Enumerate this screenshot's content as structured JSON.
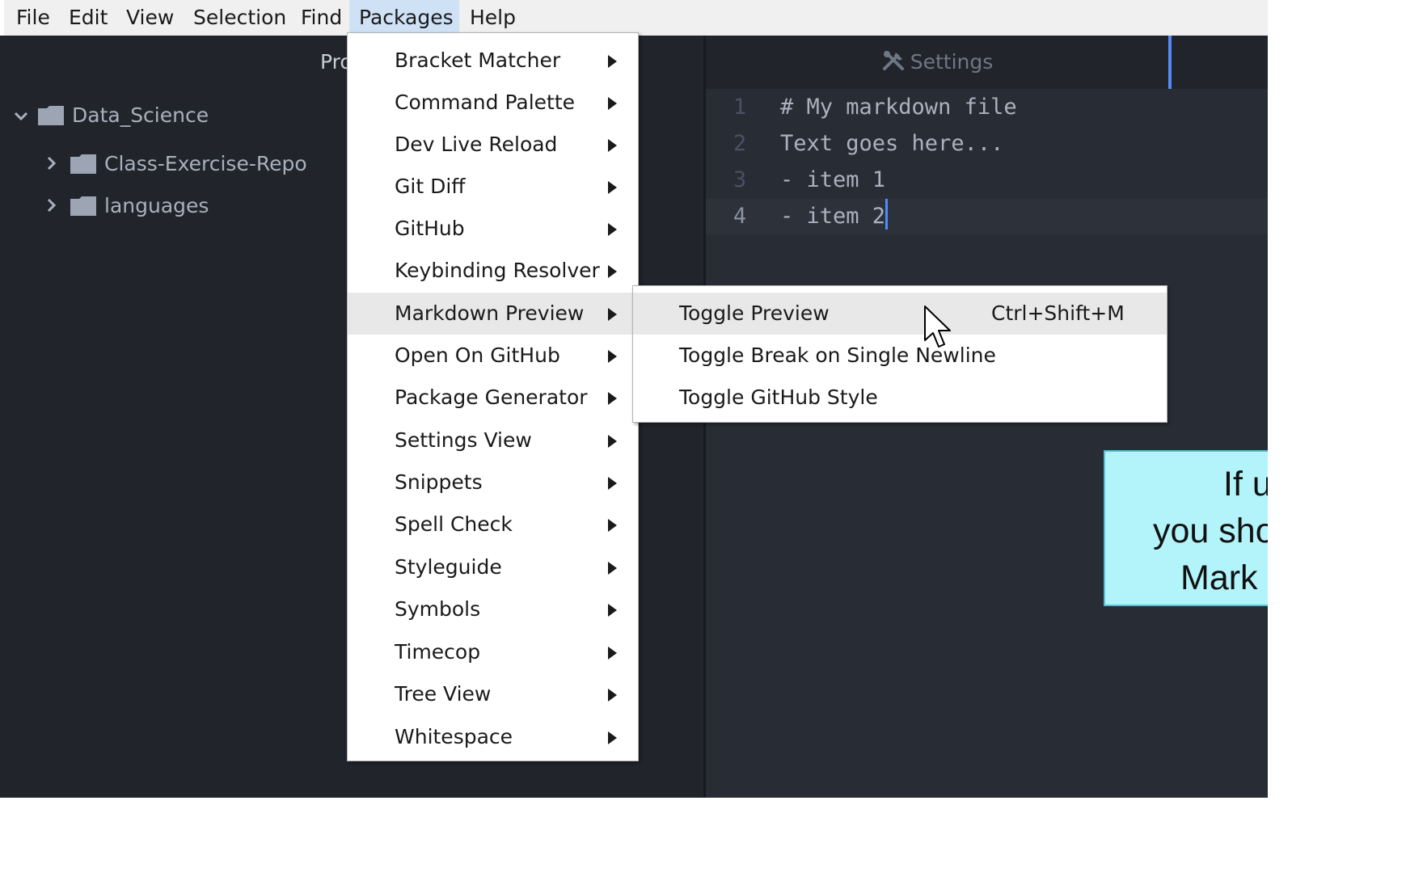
{
  "menubar": {
    "items": [
      "File",
      "Edit",
      "View",
      "Selection",
      "Find",
      "Packages",
      "Help"
    ],
    "active": "Packages"
  },
  "tree": {
    "title": "Project",
    "root": "Data_Science",
    "children": [
      "Class-Exercise-Repo",
      "languages"
    ]
  },
  "tab": {
    "label": "Settings",
    "icon": "tools-icon"
  },
  "editor": {
    "lines": [
      {
        "number": "1",
        "text": "# My markdown file"
      },
      {
        "number": "2",
        "text": "Text goes here..."
      },
      {
        "number": "3",
        "text": "- item 1"
      },
      {
        "number": "4",
        "text": "- item 2"
      }
    ],
    "current_line": 4
  },
  "packages_menu": {
    "items": [
      "Bracket Matcher",
      "Command Palette",
      "Dev Live Reload",
      "Git Diff",
      "GitHub",
      "Keybinding Resolver",
      "Markdown Preview",
      "Open On GitHub",
      "Package Generator",
      "Settings View",
      "Snippets",
      "Spell Check",
      "Styleguide",
      "Symbols",
      "Timecop",
      "Tree View",
      "Whitespace"
    ],
    "highlighted": "Markdown Preview"
  },
  "submenu": {
    "items": [
      {
        "label": "Toggle Preview",
        "shortcut": "Ctrl+Shift+M"
      },
      {
        "label": "Toggle Break on Single Newline",
        "shortcut": ""
      },
      {
        "label": "Toggle GitHub Style",
        "shortcut": ""
      }
    ],
    "highlighted": "Toggle Preview"
  },
  "callout": {
    "lines": [
      "If u",
      "you sho",
      "Mark"
    ]
  },
  "colors": {
    "accent": "#568af2",
    "callout_bg": "#b3f4fb"
  }
}
